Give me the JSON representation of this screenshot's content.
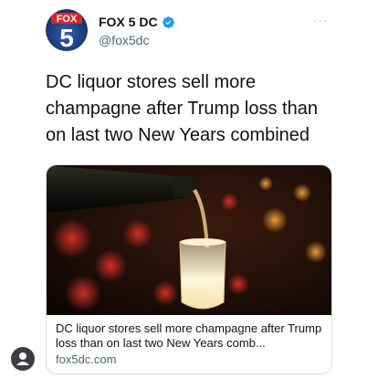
{
  "account": {
    "display_name": "FOX 5 DC",
    "handle": "@fox5dc",
    "logo_text": "FOX",
    "logo_number": "5"
  },
  "tweet": {
    "text": "DC liquor stores sell more champagne after Trump loss than on last two New Years combined",
    "more_label": "···"
  },
  "card": {
    "title": "DC liquor stores sell more champagne after Trump loss than on last two New Years comb...",
    "domain": "fox5dc.com"
  },
  "icons": {
    "verified": "verified-badge-icon",
    "more": "more-options-icon",
    "user": "user-avatar-icon"
  },
  "colors": {
    "verified_blue": "#1d9bf0",
    "fox_red": "#d9262b",
    "fox_blue": "#1a3d7c"
  }
}
